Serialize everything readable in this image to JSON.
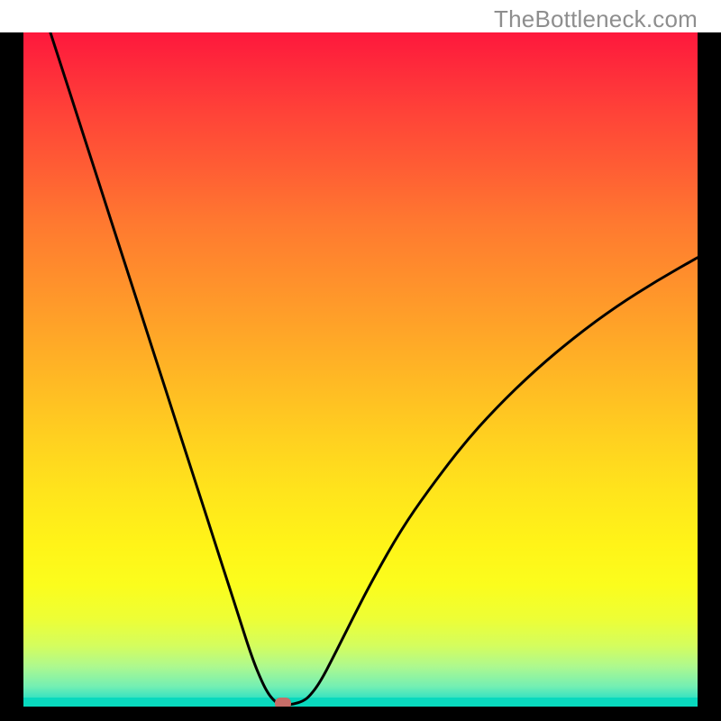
{
  "watermark": "TheBottleneck.com",
  "chart_data": {
    "type": "line",
    "title": "",
    "xlabel": "",
    "ylabel": "",
    "xlim": [
      0,
      100
    ],
    "ylim": [
      0,
      100
    ],
    "series": [
      {
        "name": "bottleneck-curve",
        "x": [
          4,
          6,
          8,
          10,
          12,
          14,
          16,
          18,
          20,
          22,
          24,
          26,
          28,
          30,
          32,
          34,
          35.5,
          36.5,
          37.5,
          38,
          38.8,
          40,
          41.5,
          42.5,
          44,
          46,
          49,
          52,
          56,
          60,
          65,
          70,
          76,
          82,
          88,
          94,
          100
        ],
        "y": [
          100,
          93.8,
          87.6,
          81.4,
          75.2,
          69,
          62.8,
          56.6,
          50.4,
          44.2,
          38,
          31.8,
          25.6,
          19.4,
          13.2,
          7,
          3.4,
          1.6,
          0.6,
          0.3,
          0.2,
          0.35,
          0.8,
          1.6,
          3.6,
          7.4,
          13.4,
          19.2,
          26.2,
          32,
          38.6,
          44.2,
          50,
          55,
          59.4,
          63.2,
          66.6
        ]
      }
    ],
    "marker": {
      "name": "optimal-point",
      "x": 38.5,
      "y": 0.5,
      "color": "#c66d68"
    },
    "gradient_colors": {
      "top": "#fe183c",
      "mid": "#ffe41c",
      "bottom": "#09d9be"
    }
  }
}
